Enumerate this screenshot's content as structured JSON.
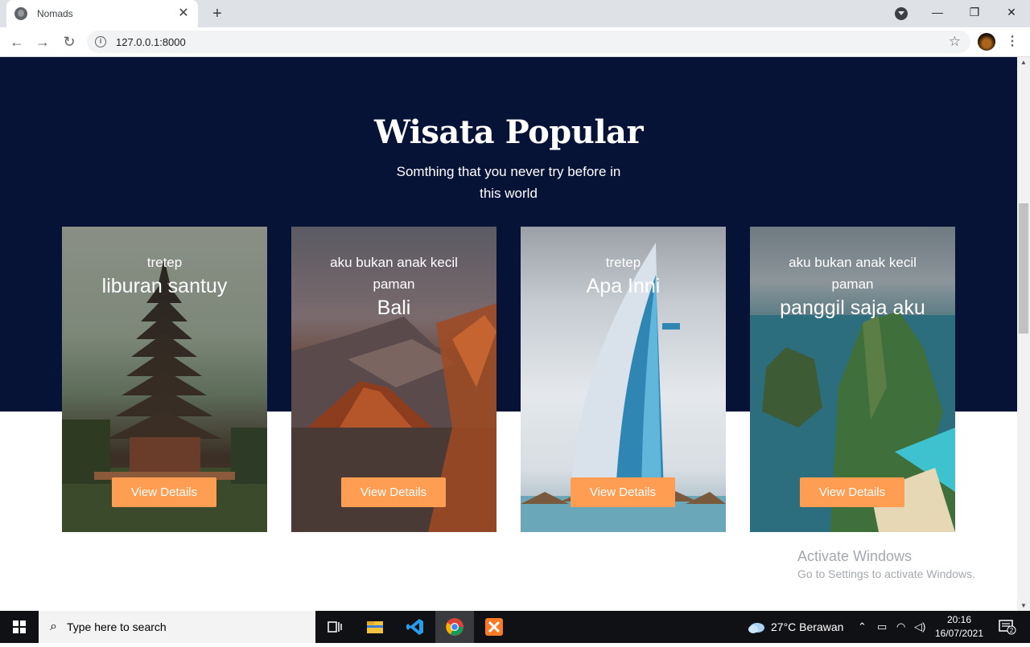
{
  "browser": {
    "tab_title": "Nomads",
    "tab_close": "✕",
    "new_tab": "+",
    "minimize": "—",
    "restore": "❐",
    "close": "✕",
    "url": "127.0.0.1:8000",
    "bookmark_icon": "star-icon"
  },
  "page": {
    "heading": "Wisata Popular",
    "subheading": "Somthing that you never try before in this world",
    "cards": [
      {
        "top": "tretep",
        "main": "liburan santuy",
        "button": "View Details",
        "image": "temple-pagoda"
      },
      {
        "top": "aku bukan anak kecil paman",
        "main": "Bali",
        "button": "View Details",
        "image": "volcano-mountain"
      },
      {
        "top": "tretep",
        "main": "Apa Inni",
        "button": "View Details",
        "image": "sail-hotel-tower"
      },
      {
        "top": "aku bukan anak kecil paman",
        "main": "panggil saja aku",
        "button": "View Details",
        "image": "sea-cliff-beach"
      }
    ],
    "colors": {
      "hero_bg": "#071237",
      "button": "#ff9e53"
    }
  },
  "watermark": {
    "line1": "Activate Windows",
    "line2": "Go to Settings to activate Windows."
  },
  "taskbar": {
    "search_placeholder": "Type here to search",
    "weather": "27°C  Berawan",
    "time": "20:16",
    "date": "16/07/2021",
    "notification_count": "2"
  }
}
